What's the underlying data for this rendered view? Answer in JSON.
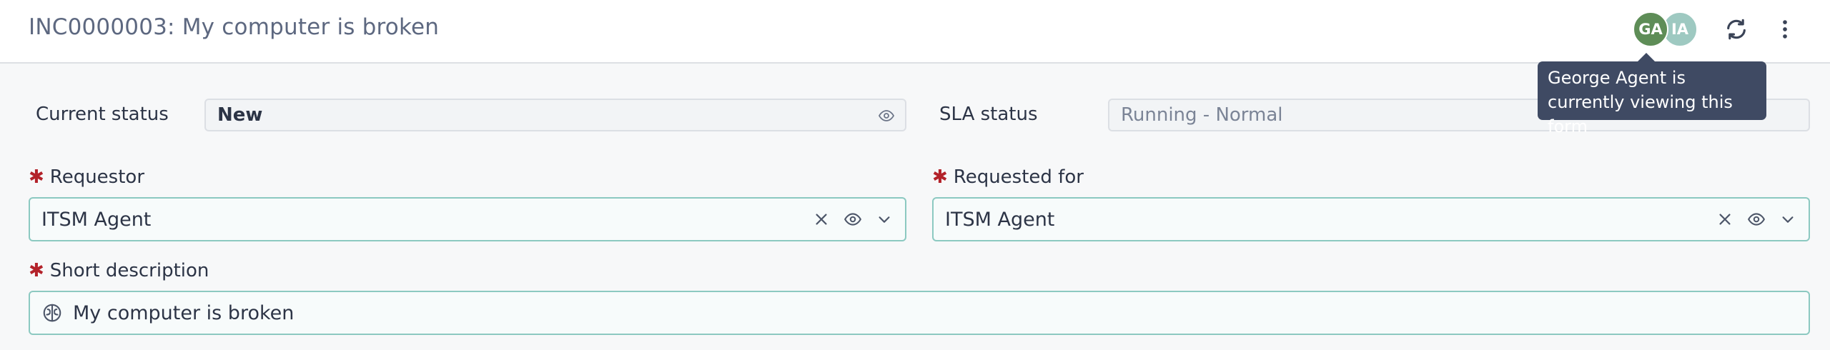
{
  "header": {
    "title": "INC0000003: My computer is broken",
    "avatars": [
      {
        "initials": "GA",
        "color": "#5e8d57"
      },
      {
        "initials": "IA",
        "color": "#9ec9c1"
      }
    ],
    "tooltip": "George Agent is currently viewing this form",
    "icons": [
      "refresh-icon",
      "more-vertical-icon"
    ]
  },
  "form": {
    "current_status": {
      "label": "Current status",
      "value": "New"
    },
    "sla_status": {
      "label": "SLA status",
      "value": "Running - Normal"
    },
    "requestor": {
      "label": "Requestor",
      "required_mark": "✱",
      "value": "ITSM Agent"
    },
    "requested_for": {
      "label": "Requested for",
      "required_mark": "✱",
      "value": "ITSM Agent"
    },
    "short_description": {
      "label": "Short description",
      "required_mark": "✱",
      "value": "My computer is broken"
    }
  },
  "colors": {
    "accent_border": "#8cc9c1",
    "required": "#b3222a",
    "tooltip_bg": "#3f4a63"
  }
}
